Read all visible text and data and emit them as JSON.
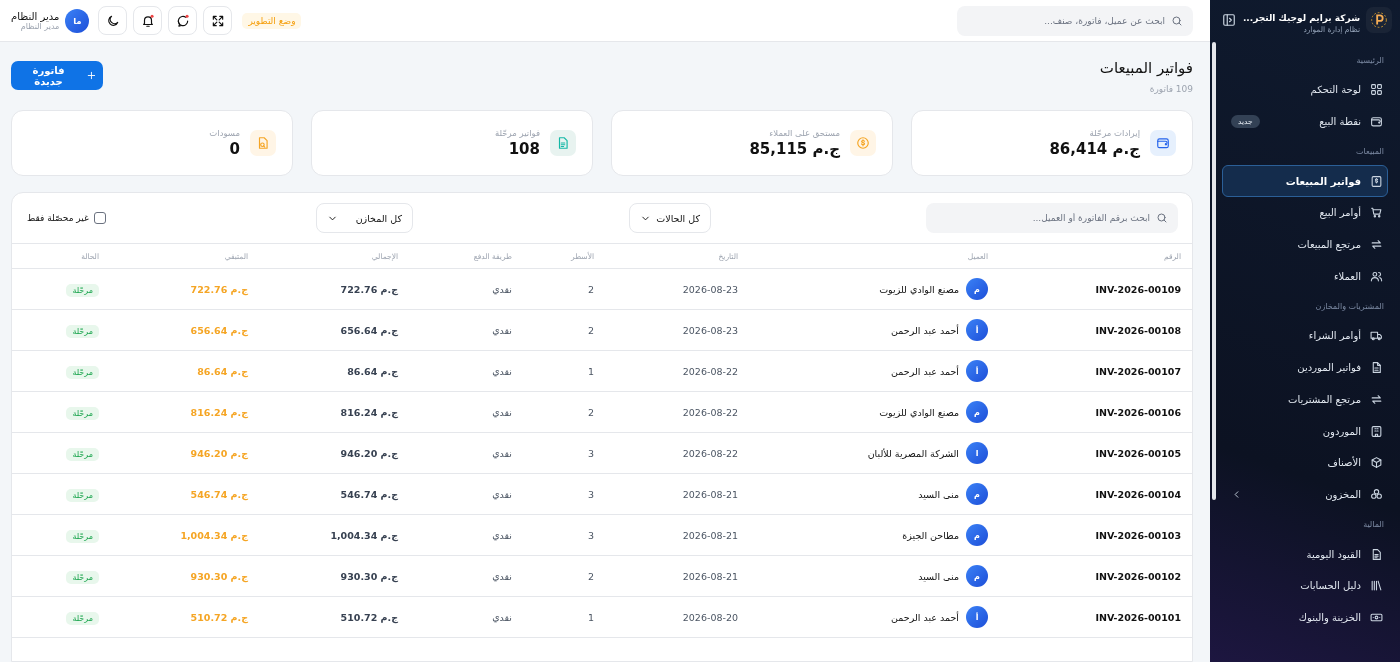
{
  "sidebar": {
    "brand": "شركة برايم لوجيك التجر...",
    "subtitle": "نظام إدارة الموارد",
    "items": [
      {
        "kind": "section",
        "label": "الرئيسية"
      },
      {
        "kind": "item",
        "label": "لوحة التحكم",
        "selected": false
      },
      {
        "kind": "item",
        "label": "نقطة البيع",
        "selected": false,
        "badge": "جديد"
      },
      {
        "kind": "section",
        "label": "المبيعات"
      },
      {
        "kind": "item",
        "label": "فواتير المبيعات",
        "selected": true
      },
      {
        "kind": "item",
        "label": "أوامر البيع",
        "selected": false
      },
      {
        "kind": "item",
        "label": "مرتجع المبيعات",
        "selected": false
      },
      {
        "kind": "item",
        "label": "العملاء",
        "selected": false
      },
      {
        "kind": "section",
        "label": "المشتريات والمخازن"
      },
      {
        "kind": "item",
        "label": "أوامر الشراء",
        "selected": false
      },
      {
        "kind": "item",
        "label": "فواتير الموردين",
        "selected": false
      },
      {
        "kind": "item",
        "label": "مرتجع المشتريات",
        "selected": false
      },
      {
        "kind": "item",
        "label": "الموردون",
        "selected": false
      },
      {
        "kind": "item",
        "label": "الأصناف",
        "selected": false
      },
      {
        "kind": "group",
        "label": "المخزون",
        "selected": false,
        "expanded": false
      },
      {
        "kind": "section",
        "label": "المالية"
      },
      {
        "kind": "item",
        "label": "القيود اليومية",
        "selected": false
      },
      {
        "kind": "item",
        "label": "دليل الحسابات",
        "selected": false
      },
      {
        "kind": "item",
        "label": "الخزينة والبنوك",
        "selected": false
      }
    ]
  },
  "header": {
    "search": {
      "placeholder": "ابحث عن عميل، فاتورة، صنف..."
    },
    "mode_badge": "وضع التطوير",
    "user": {
      "initials": "ما",
      "name": "مدير النظام",
      "role": "مدير النظام"
    }
  },
  "page": {
    "title": "فواتير المبيعات",
    "subtitle": "109 فاتورة",
    "new_button": "فاتورة جديدة"
  },
  "stats": [
    {
      "label": "إيرادات مرحّلة",
      "value": "ج.م 86,414"
    },
    {
      "label": "مستحق على العملاء",
      "value": "ج.م 85,115"
    },
    {
      "label": "فواتير مرحّلة",
      "value": "108"
    },
    {
      "label": "مسودات",
      "value": "0"
    }
  ],
  "filters": {
    "search": {
      "placeholder": "ابحث برقم الفاتورة أو العميل..."
    },
    "status": "كل الحالات",
    "warehouse": "كل المخازن",
    "unpaid_only": {
      "label": "غير محصّلة فقط",
      "checked": false
    }
  },
  "table": {
    "columns": [
      "الرقم",
      "العميل",
      "التاريخ",
      "الأسطر",
      "طريقة الدفع",
      "الإجمالي",
      "المتبقي",
      "الحالة"
    ],
    "rows": [
      {
        "number": "INV-2026-00109",
        "initial": "م",
        "customer": "مصنع الوادي للزيوت",
        "date": "2026-08-23",
        "lines": "2",
        "payment": "نقدي",
        "total": "ج.م 722.76",
        "remaining": "ج.م 722.76",
        "status": "مرحّلة"
      },
      {
        "number": "INV-2026-00108",
        "initial": "أ",
        "customer": "أحمد عبد الرحمن",
        "date": "2026-08-23",
        "lines": "2",
        "payment": "نقدي",
        "total": "ج.م 656.64",
        "remaining": "ج.م 656.64",
        "status": "مرحّلة"
      },
      {
        "number": "INV-2026-00107",
        "initial": "أ",
        "customer": "أحمد عبد الرحمن",
        "date": "2026-08-22",
        "lines": "1",
        "payment": "نقدي",
        "total": "ج.م 86.64",
        "remaining": "ج.م 86.64",
        "status": "مرحّلة"
      },
      {
        "number": "INV-2026-00106",
        "initial": "م",
        "customer": "مصنع الوادي للزيوت",
        "date": "2026-08-22",
        "lines": "2",
        "payment": "نقدي",
        "total": "ج.م 816.24",
        "remaining": "ج.م 816.24",
        "status": "مرحّلة"
      },
      {
        "number": "INV-2026-00105",
        "initial": "ا",
        "customer": "الشركة المصرية للألبان",
        "date": "2026-08-22",
        "lines": "3",
        "payment": "نقدي",
        "total": "ج.م 946.20",
        "remaining": "ج.م 946.20",
        "status": "مرحّلة"
      },
      {
        "number": "INV-2026-00104",
        "initial": "م",
        "customer": "منى السيد",
        "date": "2026-08-21",
        "lines": "3",
        "payment": "نقدي",
        "total": "ج.م 546.74",
        "remaining": "ج.م 546.74",
        "status": "مرحّلة"
      },
      {
        "number": "INV-2026-00103",
        "initial": "م",
        "customer": "مطاحن الجيزة",
        "date": "2026-08-21",
        "lines": "3",
        "payment": "نقدي",
        "total": "ج.م 1,004.34",
        "remaining": "ج.م 1,004.34",
        "status": "مرحّلة"
      },
      {
        "number": "INV-2026-00102",
        "initial": "م",
        "customer": "منى السيد",
        "date": "2026-08-21",
        "lines": "2",
        "payment": "نقدي",
        "total": "ج.م 930.30",
        "remaining": "ج.م 930.30",
        "status": "مرحّلة"
      },
      {
        "number": "INV-2026-00101",
        "initial": "أ",
        "customer": "أحمد عبد الرحمن",
        "date": "2026-08-20",
        "lines": "1",
        "payment": "نقدي",
        "total": "ج.م 510.72",
        "remaining": "ج.م 510.72",
        "status": "مرحّلة"
      }
    ]
  }
}
